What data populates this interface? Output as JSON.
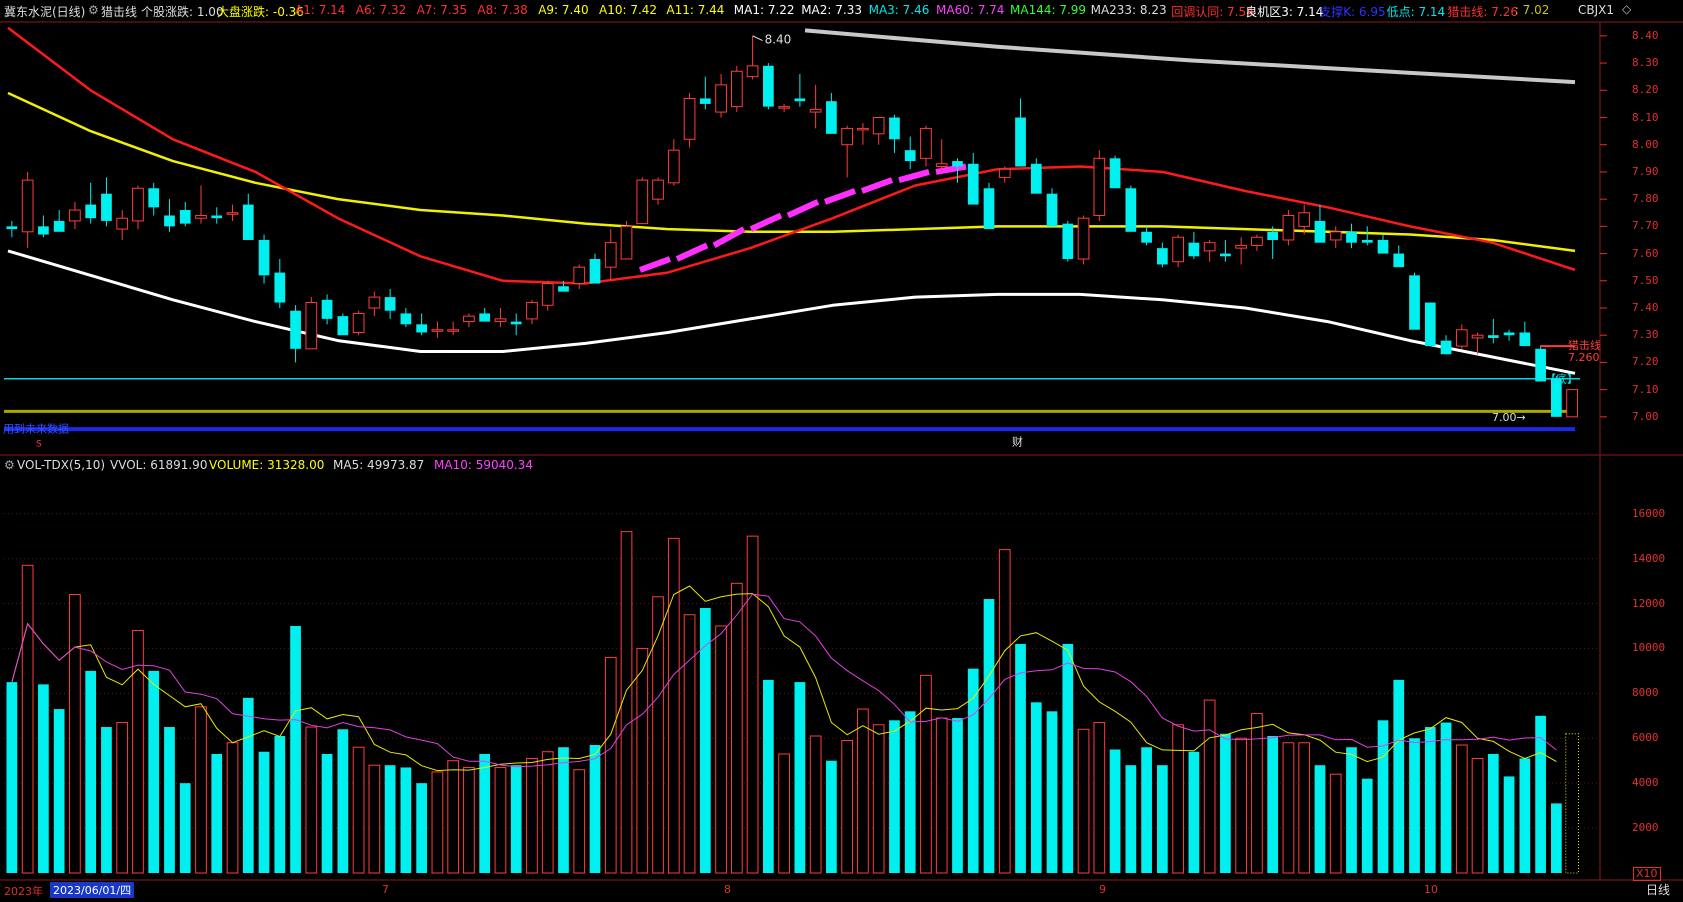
{
  "header": {
    "title": "冀东水泥(日线)",
    "indicator_name": "猎击线",
    "stock_change": "个股涨跌: 1.00",
    "market_change": "大盘涨跌: -0.36",
    "items": [
      {
        "text": "A1: 7.14",
        "color": "#ff3030"
      },
      {
        "text": "A6: 7.32",
        "color": "#ff3030"
      },
      {
        "text": "A7: 7.35",
        "color": "#ff3030"
      },
      {
        "text": "A8: 7.38",
        "color": "#ff3030"
      },
      {
        "text": "A9: 7.40",
        "color": "#ffff00"
      },
      {
        "text": "A10: 7.42",
        "color": "#ffff00"
      },
      {
        "text": "A11: 7.44",
        "color": "#ffff00"
      },
      {
        "text": "MA1: 7.22",
        "color": "#ffffff"
      },
      {
        "text": "MA2: 7.33",
        "color": "#ffffff"
      },
      {
        "text": "MA3: 7.46",
        "color": "#00e8e8"
      },
      {
        "text": "MA60: 7.74",
        "color": "#ff40ff"
      },
      {
        "text": "MA144: 7.99",
        "color": "#30ff30"
      },
      {
        "text": "MA233: 8.23",
        "color": "#dddddd"
      },
      {
        "text": "回调认同: 7.54",
        "color": "#ff3030"
      },
      {
        "text": "良机区3: 7.14",
        "color": "#ffffff"
      },
      {
        "text": "支撑K: 6.95",
        "color": "#3030ff"
      },
      {
        "text": "低点: 7.14",
        "color": "#00e8e8"
      },
      {
        "text": "猎击线: 7.26",
        "color": "#ff3030"
      },
      {
        "text": ": 7.02",
        "color": "#c8c800"
      }
    ],
    "code": "CBJX1"
  },
  "price_axis": [
    "8.40",
    "8.30",
    "8.20",
    "8.10",
    "8.00",
    "7.90",
    "7.80",
    "7.70",
    "7.60",
    "7.50",
    "7.40",
    "7.30",
    "7.20",
    "7.10",
    "7.00"
  ],
  "annotations": {
    "high_label": "8.40",
    "low_label": "7.00",
    "hunt_line_label": "猎击线",
    "hunt_line_value": "7.260",
    "bottom_tag": "【底】",
    "notice": "用到未来数据",
    "fin_marker": "财",
    "s_marker": "S"
  },
  "volume": {
    "indicator": "VOL-TDX(5,10)",
    "vvol": "VVOL: 61891.90",
    "volume": "VOLUME: 31328.00",
    "ma5": "MA5: 49973.87",
    "ma10": "MA10: 59040.34",
    "axis": [
      "16000",
      "14000",
      "12000",
      "10000",
      "8000",
      "6000",
      "4000",
      "2000"
    ],
    "unit": "X10"
  },
  "date_axis": {
    "year": "2023年",
    "selected_date": "2023/06/01/四",
    "months": [
      "7",
      "8",
      "9",
      "10"
    ]
  },
  "period_tab": "日线",
  "colors": {
    "up": "#ff3c3c",
    "down": "#00f0f0",
    "ma_red": "#ff1a1a",
    "ma_yellow": "#f0f000",
    "ma_white": "#ffffff",
    "ma_gray": "#c8c8c8",
    "magenta": "#ff30ff"
  },
  "chart_data": {
    "type": "candlestick",
    "y_range": [
      6.97,
      8.44
    ],
    "volume_range": [
      0,
      17500
    ],
    "candles": [
      [
        7.7,
        7.72,
        7.66,
        7.69
      ],
      [
        7.68,
        7.9,
        7.62,
        7.87
      ],
      [
        7.7,
        7.74,
        7.66,
        7.67
      ],
      [
        7.72,
        7.76,
        7.7,
        7.68
      ],
      [
        7.72,
        7.79,
        7.69,
        7.76
      ],
      [
        7.78,
        7.86,
        7.71,
        7.73
      ],
      [
        7.82,
        7.88,
        7.7,
        7.72
      ],
      [
        7.69,
        7.76,
        7.65,
        7.73
      ],
      [
        7.72,
        7.85,
        7.69,
        7.84
      ],
      [
        7.84,
        7.86,
        7.74,
        7.77
      ],
      [
        7.74,
        7.8,
        7.68,
        7.7
      ],
      [
        7.76,
        7.79,
        7.7,
        7.71
      ],
      [
        7.73,
        7.85,
        7.71,
        7.74
      ],
      [
        7.74,
        7.77,
        7.71,
        7.73
      ],
      [
        7.75,
        7.78,
        7.72,
        7.75
      ],
      [
        7.78,
        7.82,
        7.74,
        7.65
      ],
      [
        7.65,
        7.67,
        7.49,
        7.52
      ],
      [
        7.53,
        7.58,
        7.4,
        7.42
      ],
      [
        7.39,
        7.41,
        7.2,
        7.25
      ],
      [
        7.25,
        7.44,
        7.25,
        7.42
      ],
      [
        7.43,
        7.45,
        7.34,
        7.36
      ],
      [
        7.37,
        7.38,
        7.31,
        7.3
      ],
      [
        7.31,
        7.39,
        7.3,
        7.38
      ],
      [
        7.4,
        7.46,
        7.37,
        7.44
      ],
      [
        7.44,
        7.47,
        7.36,
        7.39
      ],
      [
        7.38,
        7.4,
        7.33,
        7.34
      ],
      [
        7.34,
        7.38,
        7.3,
        7.31
      ],
      [
        7.32,
        7.35,
        7.29,
        7.32
      ],
      [
        7.32,
        7.35,
        7.3,
        7.32
      ],
      [
        7.35,
        7.38,
        7.33,
        7.37
      ],
      [
        7.38,
        7.4,
        7.35,
        7.35
      ],
      [
        7.35,
        7.4,
        7.33,
        7.36
      ],
      [
        7.35,
        7.38,
        7.3,
        7.34
      ],
      [
        7.36,
        7.43,
        7.34,
        7.42
      ],
      [
        7.41,
        7.5,
        7.39,
        7.49
      ],
      [
        7.48,
        7.5,
        7.46,
        7.46
      ],
      [
        7.49,
        7.56,
        7.47,
        7.55
      ],
      [
        7.58,
        7.6,
        7.5,
        7.49
      ],
      [
        7.55,
        7.69,
        7.5,
        7.64
      ],
      [
        7.58,
        7.72,
        7.58,
        7.7
      ],
      [
        7.71,
        7.88,
        7.71,
        7.87
      ],
      [
        7.8,
        7.88,
        7.78,
        7.87
      ],
      [
        7.86,
        8.02,
        7.85,
        7.98
      ],
      [
        8.02,
        8.19,
        7.99,
        8.17
      ],
      [
        8.17,
        8.25,
        8.13,
        8.15
      ],
      [
        8.12,
        8.26,
        8.1,
        8.22
      ],
      [
        8.14,
        8.29,
        8.12,
        8.27
      ],
      [
        8.25,
        8.4,
        8.24,
        8.29
      ],
      [
        8.29,
        8.3,
        8.13,
        8.14
      ],
      [
        8.14,
        8.15,
        8.12,
        8.14
      ],
      [
        8.17,
        8.26,
        8.14,
        8.16
      ],
      [
        8.12,
        8.22,
        8.06,
        8.13
      ],
      [
        8.16,
        8.19,
        8.1,
        8.04
      ],
      [
        8.0,
        8.07,
        7.88,
        8.06
      ],
      [
        8.06,
        8.08,
        8.0,
        8.06
      ],
      [
        8.04,
        8.1,
        8.0,
        8.1
      ],
      [
        8.1,
        8.11,
        7.97,
        8.02
      ],
      [
        7.98,
        8.03,
        7.91,
        7.94
      ],
      [
        7.95,
        8.07,
        7.92,
        8.06
      ],
      [
        7.92,
        8.02,
        7.9,
        7.93
      ],
      [
        7.94,
        7.95,
        7.86,
        7.92
      ],
      [
        7.93,
        7.97,
        7.89,
        7.78
      ],
      [
        7.84,
        7.86,
        7.69,
        7.69
      ],
      [
        7.88,
        7.92,
        7.86,
        7.91
      ],
      [
        8.1,
        8.17,
        7.94,
        7.92
      ],
      [
        7.93,
        7.95,
        7.89,
        7.82
      ],
      [
        7.82,
        7.84,
        7.71,
        7.7
      ],
      [
        7.71,
        7.72,
        7.57,
        7.58
      ],
      [
        7.58,
        7.74,
        7.56,
        7.73
      ],
      [
        7.74,
        7.98,
        7.72,
        7.95
      ],
      [
        7.95,
        7.96,
        7.85,
        7.84
      ],
      [
        7.84,
        7.85,
        7.69,
        7.68
      ],
      [
        7.68,
        7.7,
        7.63,
        7.64
      ],
      [
        7.62,
        7.64,
        7.55,
        7.56
      ],
      [
        7.57,
        7.67,
        7.55,
        7.66
      ],
      [
        7.64,
        7.68,
        7.58,
        7.59
      ],
      [
        7.61,
        7.65,
        7.57,
        7.64
      ],
      [
        7.6,
        7.65,
        7.57,
        7.59
      ],
      [
        7.62,
        7.66,
        7.56,
        7.63
      ],
      [
        7.63,
        7.67,
        7.61,
        7.66
      ],
      [
        7.68,
        7.7,
        7.58,
        7.65
      ],
      [
        7.65,
        7.76,
        7.63,
        7.74
      ],
      [
        7.7,
        7.78,
        7.67,
        7.75
      ],
      [
        7.72,
        7.78,
        7.65,
        7.64
      ],
      [
        7.65,
        7.7,
        7.62,
        7.68
      ],
      [
        7.68,
        7.71,
        7.62,
        7.64
      ],
      [
        7.65,
        7.7,
        7.63,
        7.64
      ],
      [
        7.65,
        7.67,
        7.6,
        7.6
      ],
      [
        7.6,
        7.63,
        7.56,
        7.55
      ],
      [
        7.52,
        7.53,
        7.42,
        7.32
      ],
      [
        7.42,
        7.42,
        7.26,
        7.26
      ],
      [
        7.28,
        7.3,
        7.23,
        7.23
      ],
      [
        7.26,
        7.34,
        7.25,
        7.32
      ],
      [
        7.29,
        7.31,
        7.23,
        7.3
      ],
      [
        7.3,
        7.36,
        7.27,
        7.29
      ],
      [
        7.31,
        7.32,
        7.28,
        7.3
      ],
      [
        7.31,
        7.35,
        7.27,
        7.26
      ],
      [
        7.25,
        7.26,
        7.13,
        7.13
      ],
      [
        7.14,
        7.15,
        7.0,
        7.0
      ],
      [
        7.0,
        7.1,
        7.0,
        7.1
      ]
    ],
    "volumes": [
      8500,
      13700,
      8400,
      7300,
      12400,
      9000,
      6500,
      6700,
      10800,
      9000,
      6500,
      4000,
      7400,
      5300,
      5800,
      7800,
      5400,
      6100,
      11000,
      6500,
      5300,
      6400,
      5600,
      4800,
      4800,
      4700,
      4000,
      4500,
      5000,
      4700,
      5300,
      4700,
      4800,
      5100,
      5400,
      5600,
      4600,
      5700,
      9600,
      15200,
      10000,
      12300,
      14900,
      11500,
      11800,
      11000,
      12900,
      15000,
      8600,
      5300,
      8500,
      6100,
      5000,
      5900,
      7300,
      6600,
      6800,
      7200,
      8800,
      6900,
      6900,
      9100,
      12200,
      14400,
      10200,
      7600,
      7200,
      10200,
      6400,
      6700,
      5500,
      4800,
      5600,
      4800,
      6600,
      5400,
      7700,
      6200,
      6000,
      7100,
      6100,
      5800,
      5800,
      4800,
      4400,
      5600,
      4200,
      6800,
      8600,
      6000,
      6500,
      6700,
      5700,
      5100,
      5300,
      4300,
      5100,
      7000,
      3100
    ],
    "ma_lines": {
      "red": [
        8.43,
        8.2,
        8.02,
        7.9,
        7.73,
        7.59,
        7.5,
        7.49,
        7.53,
        7.62,
        7.73,
        7.85,
        7.91,
        7.92,
        7.9,
        7.83,
        7.77,
        7.7,
        7.64,
        7.54
      ],
      "yellow": [
        8.19,
        8.05,
        7.94,
        7.86,
        7.8,
        7.76,
        7.74,
        7.71,
        7.69,
        7.68,
        7.68,
        7.69,
        7.7,
        7.7,
        7.7,
        7.69,
        7.68,
        7.67,
        7.65,
        7.61
      ],
      "white": [
        7.61,
        7.52,
        7.43,
        7.35,
        7.28,
        7.24,
        7.24,
        7.27,
        7.31,
        7.36,
        7.41,
        7.44,
        7.45,
        7.45,
        7.43,
        7.4,
        7.35,
        7.28,
        7.22,
        7.16
      ],
      "gray": [
        8.42,
        8.36,
        8.31,
        8.27,
        8.23
      ],
      "magenta": [
        7.54,
        7.58,
        7.63,
        7.69,
        7.74,
        7.79,
        7.83,
        7.87,
        7.9,
        7.92
      ]
    }
  }
}
